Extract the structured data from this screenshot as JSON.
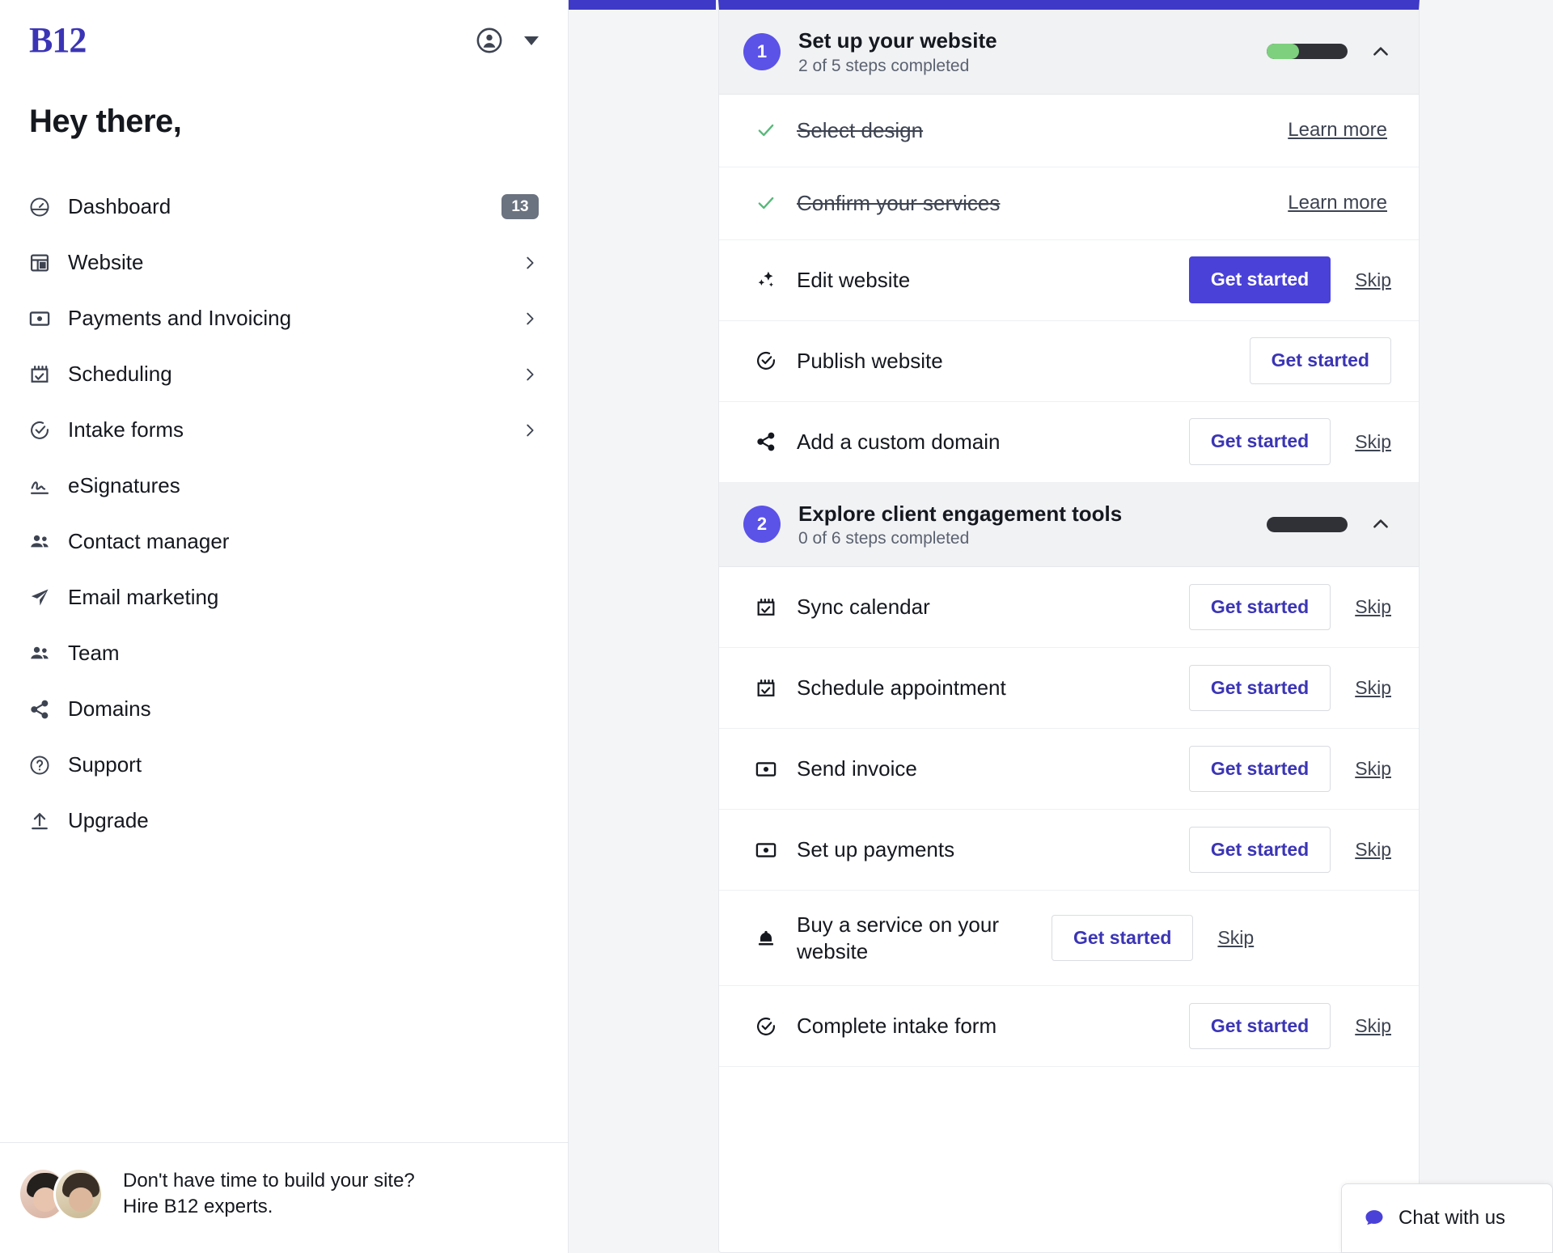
{
  "sidebar": {
    "brand": "B12",
    "account_icon": "account-circle-icon",
    "dropdown_icon": "chevron-down-icon",
    "greeting": "Hey there,",
    "items": [
      {
        "label": "Dashboard",
        "icon": "dashboard-gauge-icon",
        "badge": "13",
        "chevron": false
      },
      {
        "label": "Website",
        "icon": "layout-icon",
        "badge": null,
        "chevron": true
      },
      {
        "label": "Payments and Invoicing",
        "icon": "payment-card-icon",
        "badge": null,
        "chevron": true
      },
      {
        "label": "Scheduling",
        "icon": "calendar-check-icon",
        "badge": null,
        "chevron": true
      },
      {
        "label": "Intake forms",
        "icon": "check-circle-icon",
        "badge": null,
        "chevron": true
      },
      {
        "label": "eSignatures",
        "icon": "signature-icon",
        "badge": null,
        "chevron": false
      },
      {
        "label": "Contact manager",
        "icon": "people-icon",
        "badge": null,
        "chevron": false
      },
      {
        "label": "Email marketing",
        "icon": "paper-plane-icon",
        "badge": null,
        "chevron": false
      },
      {
        "label": "Team",
        "icon": "people-icon",
        "badge": null,
        "chevron": false
      },
      {
        "label": "Domains",
        "icon": "share-nodes-icon",
        "badge": null,
        "chevron": false
      },
      {
        "label": "Support",
        "icon": "question-circle-icon",
        "badge": null,
        "chevron": false
      },
      {
        "label": "Upgrade",
        "icon": "upload-arrow-icon",
        "badge": null,
        "chevron": false
      }
    ],
    "promo": {
      "line1": "Don't have time to build your site?",
      "line2": "Hire B12 experts."
    }
  },
  "checklist": {
    "sections": [
      {
        "number": "1",
        "title": "Set up your website",
        "subtitle": "2 of 5 steps completed",
        "progress_percent": 40,
        "collapse_icon": "chevron-up-icon",
        "tasks": [
          {
            "label": "Select design",
            "icon": "check-icon",
            "state": "done",
            "action": "Learn more",
            "skip": null
          },
          {
            "label": "Confirm your services",
            "icon": "check-icon",
            "state": "done",
            "action": "Learn more",
            "skip": null
          },
          {
            "label": "Edit website",
            "icon": "edit-sparkle-icon",
            "state": "active",
            "action": "Get started",
            "skip": "Skip"
          },
          {
            "label": "Publish website",
            "icon": "check-circle-icon",
            "state": "todo",
            "action": "Get started",
            "skip": null
          },
          {
            "label": "Add a custom domain",
            "icon": "share-nodes-icon",
            "state": "todo",
            "action": "Get started",
            "skip": "Skip"
          }
        ]
      },
      {
        "number": "2",
        "title": "Explore client engagement tools",
        "subtitle": "0 of 6 steps completed",
        "progress_percent": 0,
        "collapse_icon": "chevron-up-icon",
        "tasks": [
          {
            "label": "Sync calendar",
            "icon": "calendar-check-icon",
            "state": "todo",
            "action": "Get started",
            "skip": "Skip"
          },
          {
            "label": "Schedule appointment",
            "icon": "calendar-check-icon",
            "state": "todo",
            "action": "Get started",
            "skip": "Skip"
          },
          {
            "label": "Send invoice",
            "icon": "payment-card-icon",
            "state": "todo",
            "action": "Get started",
            "skip": "Skip"
          },
          {
            "label": "Set up payments",
            "icon": "payment-card-icon",
            "state": "todo",
            "action": "Get started",
            "skip": "Skip"
          },
          {
            "label": "Buy a service on your website",
            "icon": "bell-service-icon",
            "state": "todo",
            "action": "Get started",
            "skip": "Skip"
          },
          {
            "label": "Complete intake form",
            "icon": "check-circle-icon",
            "state": "todo",
            "action": "Get started",
            "skip": "Skip"
          }
        ]
      }
    ]
  },
  "chat": {
    "label": "Chat with us",
    "icon": "chat-bubble-icon"
  },
  "colors": {
    "brand_purple": "#3b35b5",
    "accent_purple": "#4a41d8",
    "topbar_purple": "#3f39c7",
    "section_badge": "#5b52e8",
    "progress_green": "#7ed07e",
    "progress_track": "#2f3137",
    "check_green": "#58b87a",
    "badge_gray": "#6b7280"
  }
}
